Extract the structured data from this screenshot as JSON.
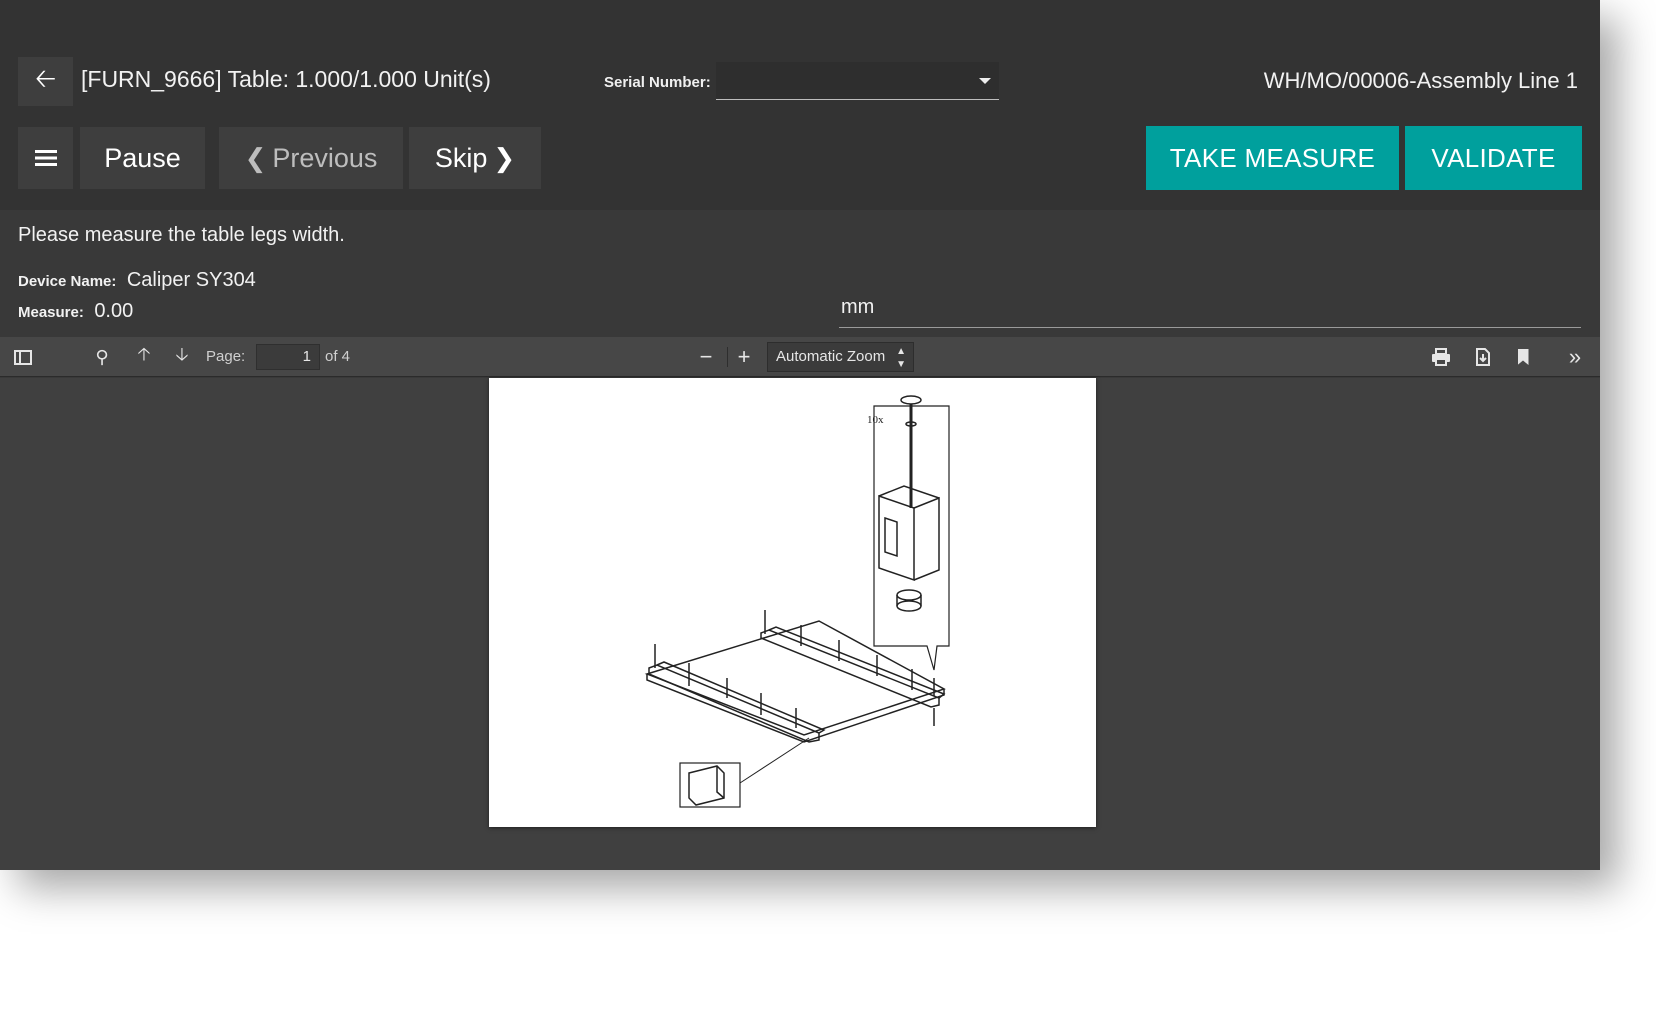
{
  "header": {
    "product_title": "[FURN_9666] Table: 1.000/1.000 Unit(s)",
    "serial_label": "Serial Number:",
    "serial_value": "",
    "workorder": "WH/MO/00006-Assembly Line 1"
  },
  "toolbar": {
    "pause_label": "Pause",
    "previous_label": "Previous",
    "skip_label": "Skip",
    "take_measure_label": "TAKE MEASURE",
    "validate_label": "VALIDATE"
  },
  "step": {
    "instruction": "Please measure the table legs width.",
    "device_label": "Device Name:",
    "device_value": "Caliper SY304",
    "measure_label": "Measure:",
    "measure_value": "0.00",
    "unit": "mm"
  },
  "pdf_viewer": {
    "page_label": "Page:",
    "page_current": "1",
    "page_of": "of 4",
    "zoom_value": "Automatic Zoom",
    "drawing_callout": "10x"
  },
  "colors": {
    "accent": "#00a09d",
    "header_bg": "#333333",
    "body_bg": "#393939",
    "pdf_bg": "#404040"
  },
  "icons": {
    "back": "arrow-left-icon",
    "menu": "hamburger-icon",
    "previous": "chevron-left-icon",
    "skip": "chevron-right-icon",
    "sidebar": "sidebar-toggle-icon",
    "search": "search-icon",
    "page_up": "arrow-up-icon",
    "page_down": "arrow-down-icon",
    "zoom_out": "minus-icon",
    "zoom_in": "plus-icon",
    "print": "print-icon",
    "download": "download-icon",
    "bookmark": "bookmark-icon",
    "tools": "double-chevron-right-icon"
  }
}
